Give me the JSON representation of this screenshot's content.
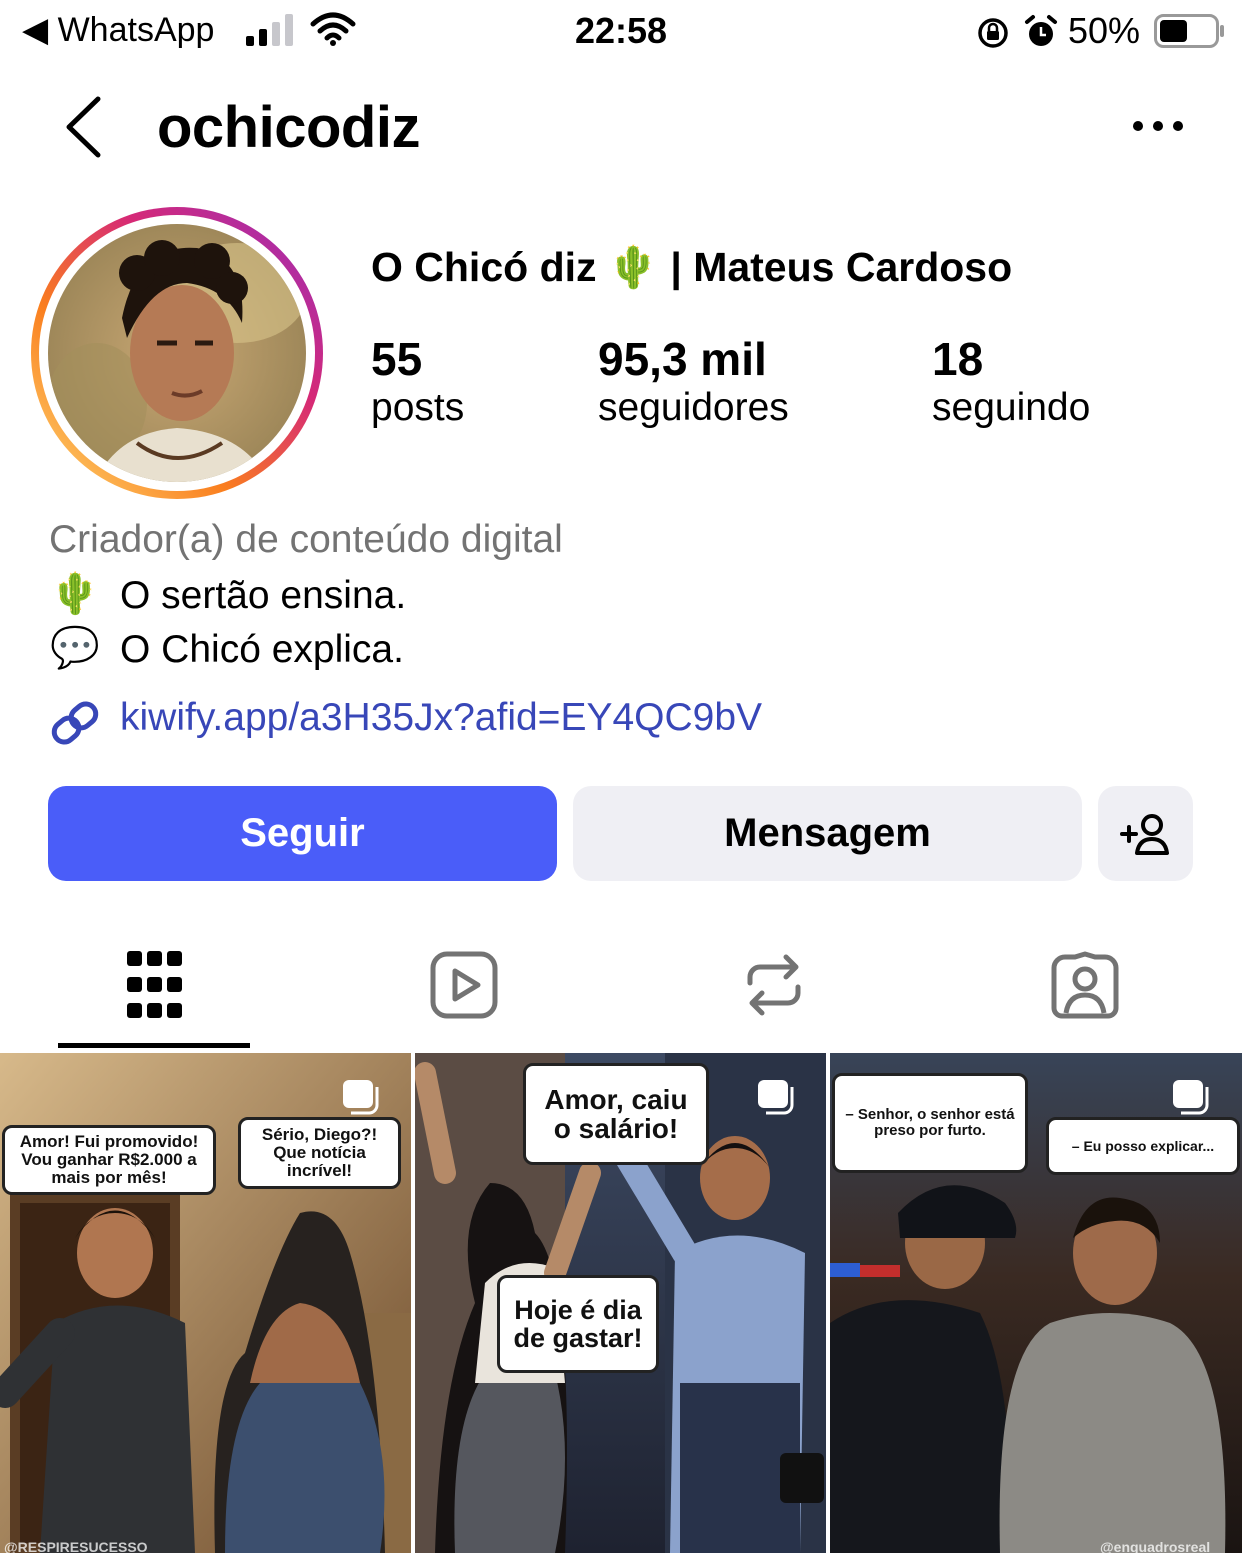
{
  "status_bar": {
    "back_app": "◀ WhatsApp",
    "time": "22:58",
    "battery_percent": "50%",
    "battery_level": 0.5
  },
  "header": {
    "username": "ochicodiz"
  },
  "profile": {
    "display_name": "O Chicó diz 🌵 | Mateus Cardoso",
    "stats": [
      {
        "value": "55",
        "label": "posts"
      },
      {
        "value": "95,3 mil",
        "label": "seguidores"
      },
      {
        "value": "18",
        "label": "seguindo"
      }
    ],
    "category": "Criador(a) de conteúdo digital",
    "bio": [
      {
        "emoji": "🌵",
        "text": "O sertão ensina."
      },
      {
        "emoji": "💬",
        "text": "O Chicó explica."
      }
    ],
    "link": "kiwify.app/a3H35Jx?afid=EY4QC9bV"
  },
  "actions": {
    "follow_label": "Seguir",
    "message_label": "Mensagem"
  },
  "posts": [
    {
      "bubbles": [
        "Amor! Fui promovido! Vou ganhar R$2.000 a mais por mês!",
        "Sério, Diego?! Que notícia incrível!"
      ],
      "watermark": "@RESPIRESUCESSO"
    },
    {
      "bubbles": [
        "Amor, caiu o salário!",
        "Hoje é dia de gastar!"
      ],
      "watermark": ""
    },
    {
      "bubbles": [
        "– Senhor, o senhor está preso por furto.",
        "– Eu posso explicar..."
      ],
      "watermark": "@enquadrosreal"
    }
  ]
}
